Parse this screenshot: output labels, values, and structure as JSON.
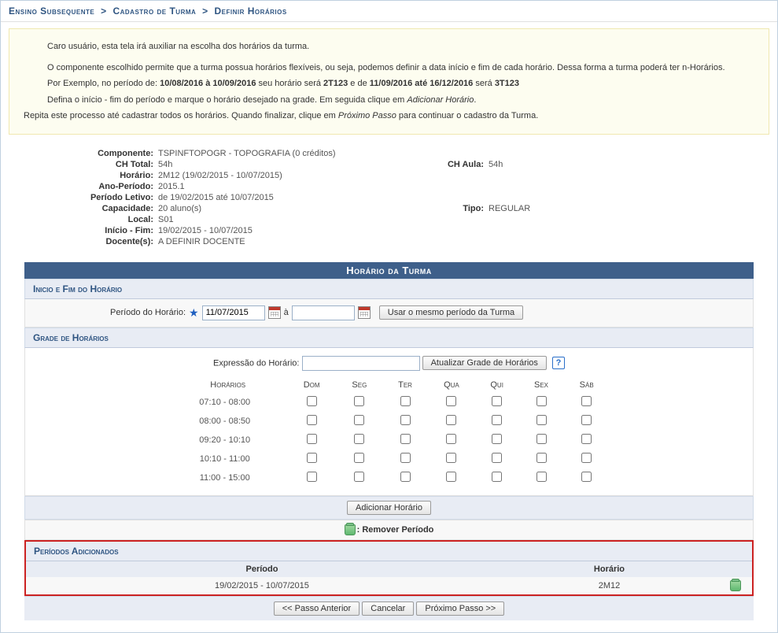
{
  "breadcrumb": {
    "seg1": "Ensino Subsequente",
    "seg2": "Cadastro de Turma",
    "seg3": "Definir Horários",
    "sep": ">"
  },
  "info": {
    "l1": "Caro usuário, esta tela irá auxiliar na escolha dos horários da turma.",
    "l2": "O componente escolhido permite que a turma possua horários flexíveis, ou seja, podemos definir a data início e fim de cada horário. Dessa forma a turma poderá ter n-Horários.",
    "l3a": "Por Exemplo, no período de: ",
    "l3b": "10/08/2016 à 10/09/2016",
    "l3c": " seu horário será ",
    "l3d": "2T123",
    "l3e": " e de ",
    "l3f": "11/09/2016 até 16/12/2016",
    "l3g": " será ",
    "l3h": "3T123",
    "l4a": "Defina o início - fim do período e marque o horário desejado na grade. Em seguida clique em ",
    "l4b": "Adicionar Horário",
    "l4c": ".",
    "l5a": "Repita este processo até cadastrar todos os horários. Quando finalizar, clique em ",
    "l5b": "Próximo Passo",
    "l5c": " para continuar o cadastro da Turma."
  },
  "details": {
    "componente_label": "Componente:",
    "componente_value": "TSPINFTOPOGR - TOPOGRAFIA (0 créditos)",
    "chtotal_label": "CH Total:",
    "chtotal_value": "54h",
    "chaula_label": "CH Aula:",
    "chaula_value": "54h",
    "horario_label": "Horário:",
    "horario_value": "2M12 (19/02/2015 - 10/07/2015)",
    "anoperiodo_label": "Ano-Período:",
    "anoperiodo_value": "2015.1",
    "periodoletivo_label": "Período Letivo:",
    "periodoletivo_value": "de 19/02/2015 até 10/07/2015",
    "capacidade_label": "Capacidade:",
    "capacidade_value": "20 aluno(s)",
    "tipo_label": "Tipo:",
    "tipo_value": "REGULAR",
    "local_label": "Local:",
    "local_value": "S01",
    "iniciofim_label": "Início - Fim:",
    "iniciofim_value": "19/02/2015 - 10/07/2015",
    "docentes_label": "Docente(s):",
    "docentes_value": "A DEFINIR DOCENTE"
  },
  "section": {
    "title": "Horário da Turma",
    "sub1": "Inicio e Fim do Horário",
    "periodo_label": "Período do Horário:",
    "periodo_a": "à",
    "date_start": "11/07/2015",
    "btn_same_period": "Usar o mesmo período da Turma",
    "sub2": "Grade de Horários",
    "expr_label": "Expressão do Horário:",
    "btn_update_grade": "Atualizar Grade de Horários",
    "help": "?",
    "th_horarios": "Horários",
    "days": [
      "Dom",
      "Seg",
      "Ter",
      "Qua",
      "Qui",
      "Sex",
      "Sáb"
    ],
    "rows": [
      "07:10 - 08:00",
      "08:00 - 08:50",
      "09:20 - 10:10",
      "10:10 - 11:00",
      "11:00 - 15:00"
    ],
    "btn_add": "Adicionar Horário",
    "legend": ": Remover Período",
    "sub3": "Períodos Adicionados",
    "th_periodo": "Período",
    "th_horario": "Horário",
    "row_periodo": "19/02/2015 - 10/07/2015",
    "row_horario": "2M12",
    "btn_prev": "<< Passo Anterior",
    "btn_cancel": "Cancelar",
    "btn_next": "Próximo Passo >>"
  }
}
